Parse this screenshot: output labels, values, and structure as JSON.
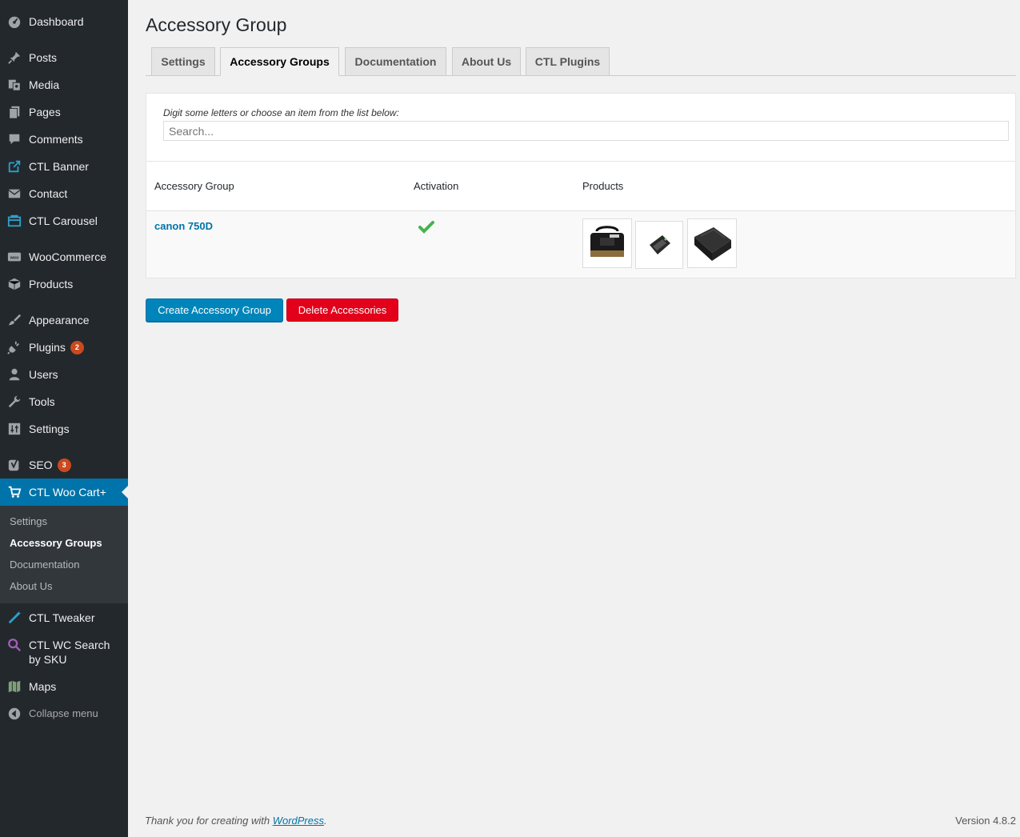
{
  "sidebar": {
    "items": [
      {
        "label": "Dashboard",
        "icon": "dashboard-icon"
      },
      {
        "label": "Posts",
        "icon": "pin-icon"
      },
      {
        "label": "Media",
        "icon": "media-icon"
      },
      {
        "label": "Pages",
        "icon": "pages-icon"
      },
      {
        "label": "Comments",
        "icon": "comment-icon"
      },
      {
        "label": "CTL Banner",
        "icon": "external-link-icon"
      },
      {
        "label": "Contact",
        "icon": "envelope-icon"
      },
      {
        "label": "CTL Carousel",
        "icon": "carousel-icon"
      },
      {
        "label": "WooCommerce",
        "icon": "woo-icon"
      },
      {
        "label": "Products",
        "icon": "box-icon"
      },
      {
        "label": "Appearance",
        "icon": "brush-icon"
      },
      {
        "label": "Plugins",
        "icon": "plug-icon",
        "badge": "2"
      },
      {
        "label": "Users",
        "icon": "user-icon"
      },
      {
        "label": "Tools",
        "icon": "wrench-icon"
      },
      {
        "label": "Settings",
        "icon": "sliders-icon"
      },
      {
        "label": "SEO",
        "icon": "yoast-icon",
        "badge": "3"
      },
      {
        "label": "CTL Woo Cart+",
        "icon": "cart-icon"
      },
      {
        "label": "CTL Tweaker",
        "icon": "wand-icon"
      },
      {
        "label": "CTL WC Search by SKU",
        "icon": "magnifier-icon"
      },
      {
        "label": "Maps",
        "icon": "map-icon"
      },
      {
        "label": "Collapse menu",
        "icon": "collapse-icon"
      }
    ],
    "submenu": [
      "Settings",
      "Accessory Groups",
      "Documentation",
      "About Us"
    ]
  },
  "page": {
    "title": "Accessory Group",
    "tabs": [
      "Settings",
      "Accessory Groups",
      "Documentation",
      "About Us",
      "CTL Plugins"
    ],
    "active_tab": "Accessory Groups"
  },
  "search": {
    "hint": "Digit some letters or choose an item from the list below:",
    "placeholder": "Search..."
  },
  "table": {
    "headers": [
      "Accessory Group",
      "Activation",
      "Products"
    ],
    "rows": [
      {
        "group": "canon 750D",
        "active": true,
        "products": [
          "camera-bag",
          "battery-charger",
          "camera-battery"
        ]
      }
    ]
  },
  "buttons": {
    "create": "Create Accessory Group",
    "delete": "Delete Accessories"
  },
  "footer": {
    "thanks_prefix": "Thank you for creating with ",
    "thanks_link": "WordPress",
    "thanks_suffix": ".",
    "version": "Version 4.8.2"
  },
  "colors": {
    "sidebar_bg": "#23282d",
    "accent": "#0073aa",
    "delete": "#e2001a",
    "check": "#46b450"
  }
}
